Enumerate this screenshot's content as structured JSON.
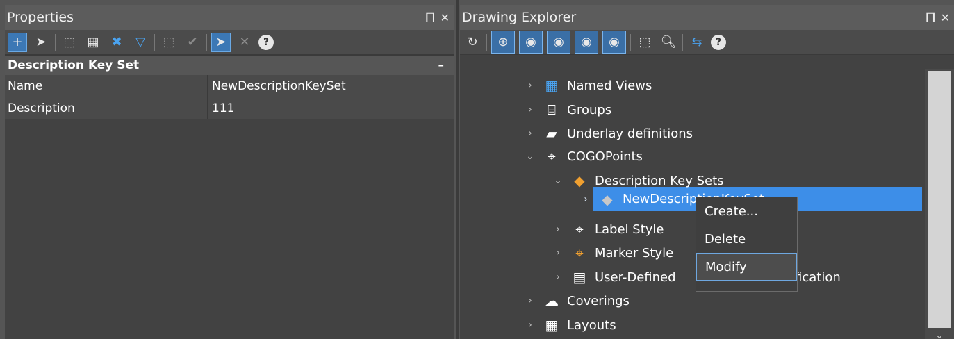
{
  "properties": {
    "title": "Properties",
    "section": "Description Key Set",
    "collapse": "–",
    "rows": [
      {
        "key": "Name",
        "value": "NewDescriptionKeySet"
      },
      {
        "key": "Description",
        "value": "111"
      }
    ]
  },
  "explorer": {
    "title": "Drawing Explorer",
    "tree": [
      {
        "label": "Named Views",
        "icon": "named-views-icon"
      },
      {
        "label": "Groups",
        "icon": "groups-icon"
      },
      {
        "label": "Underlay definitions",
        "icon": "underlay-icon"
      },
      {
        "label": "COGOPoints",
        "icon": "cogo-point-icon"
      },
      {
        "label": "Description Key Sets",
        "icon": "tag-icon"
      },
      {
        "label": "NewDescriptionKeySet",
        "icon": "tag-icon"
      },
      {
        "label": "Label Style",
        "icon": "label-style-icon"
      },
      {
        "label": "Marker Style",
        "icon": "marker-style-icon"
      },
      {
        "label": "User-Defined",
        "label_tail": "ification",
        "icon": "list-icon"
      },
      {
        "label": "Coverings",
        "icon": "coverings-icon"
      },
      {
        "label": "Layouts",
        "icon": "layouts-icon"
      }
    ]
  },
  "context_menu": {
    "items": [
      "Create...",
      "Delete",
      "Modify"
    ]
  },
  "window_controls": {
    "pin": "⊥",
    "close": "✕"
  },
  "colors": {
    "accent": "#3d8ee8",
    "panel": "#424242",
    "titlebar": "#5c5c5c",
    "orange": "#f0a030"
  }
}
